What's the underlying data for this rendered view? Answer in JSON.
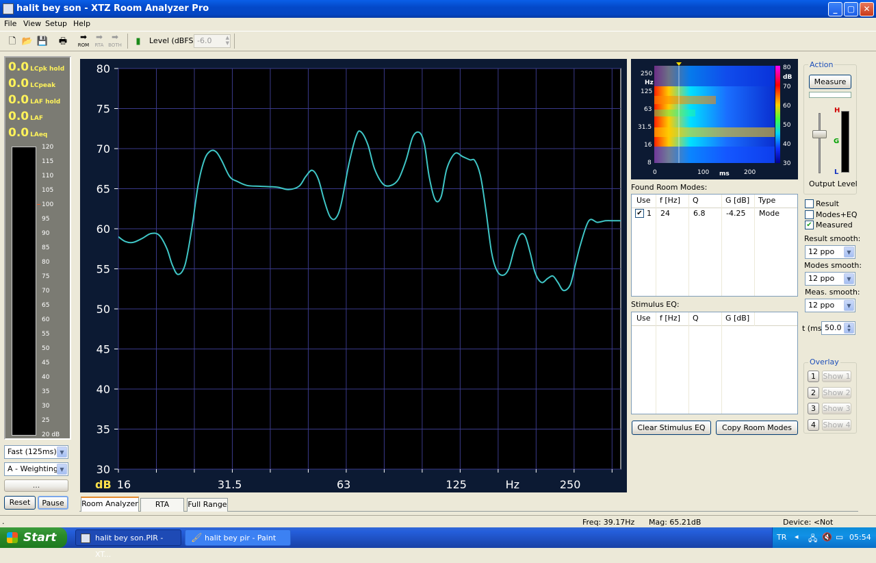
{
  "window": {
    "title": "halit bey son - XTZ Room Analyzer Pro",
    "min": "_",
    "max": "▢",
    "close": "✕"
  },
  "menu": [
    "File",
    "View",
    "Setup",
    "Help"
  ],
  "toolbar": {
    "rom": "ROM",
    "rta": "RTA",
    "both": "BOTH",
    "level_label": "Level (dBFS)",
    "level_value": "-6.0"
  },
  "meter": {
    "rows": [
      {
        "value": "0.0",
        "label": "LCpk hold"
      },
      {
        "value": "0.0",
        "label": "LCpeak"
      },
      {
        "value": "0.0",
        "label": "LAF hold"
      },
      {
        "value": "0.0",
        "label": "LAF"
      },
      {
        "value": "0.0",
        "label": "LAeq"
      }
    ],
    "scale": [
      "120",
      "115",
      "110",
      "105",
      "100",
      "95",
      "90",
      "85",
      "80",
      "75",
      "70",
      "65",
      "60",
      "55",
      "50",
      "45",
      "40",
      "35",
      "30",
      "25",
      "20 dB"
    ],
    "speed": "Fast (125ms)",
    "weighting": "A - Weighting",
    "dots": "...",
    "reset": "Reset",
    "pause": "Pause"
  },
  "chart_data": {
    "type": "line",
    "xlabel": "Hz",
    "ylabel": "dB",
    "x_scale": "log",
    "xlim": [
      16,
      340
    ],
    "ylim": [
      30,
      80
    ],
    "y_ticks": [
      30,
      35,
      40,
      45,
      50,
      55,
      60,
      65,
      70,
      75,
      80
    ],
    "x_tick_labels": [
      "16",
      "31.5",
      "63",
      "125",
      "Hz",
      "250"
    ],
    "grid": true,
    "line_color": "#3fc6c6",
    "series": [
      {
        "x": [
          16,
          16.7,
          17.5,
          18.5,
          19.5,
          20.5,
          21.5,
          22.2,
          23,
          24,
          25,
          26,
          27,
          28,
          29,
          30,
          31.5,
          33,
          35,
          38,
          42,
          45,
          48,
          50,
          52,
          54,
          56,
          58,
          60,
          62,
          65,
          68,
          70,
          73,
          76,
          80,
          84,
          88,
          92,
          96,
          100,
          103,
          106,
          110,
          114,
          118,
          124,
          130,
          136,
          140,
          145,
          150,
          155,
          160,
          166,
          172,
          178,
          184,
          190,
          196,
          202,
          210,
          218,
          225,
          232,
          240,
          250,
          258,
          266,
          280,
          295,
          310,
          325,
          335,
          340
        ],
        "y": [
          59,
          58.4,
          58.3,
          58.8,
          59.4,
          59.2,
          57.5,
          55.5,
          54.3,
          55.5,
          60,
          65.5,
          68.6,
          69.7,
          69.6,
          68.5,
          66.5,
          65.9,
          65.4,
          65.3,
          65.2,
          64.9,
          65.3,
          66.5,
          67.3,
          66.2,
          63.5,
          61.5,
          61.3,
          63,
          68,
          71.6,
          72.1,
          70.5,
          67.5,
          65.6,
          65.4,
          66.2,
          68.5,
          71.5,
          72,
          70.5,
          66.5,
          63.6,
          64,
          67.5,
          69.4,
          69,
          68.6,
          68.5,
          66.5,
          62,
          57,
          54.8,
          54.2,
          55,
          57.5,
          59.2,
          59.1,
          57,
          54.5,
          53.3,
          53.8,
          54.1,
          53.3,
          52.3,
          53,
          55.5,
          58,
          61,
          60.8,
          61,
          61,
          61,
          61
        ]
      }
    ]
  },
  "spectrogram": {
    "y_labels": [
      "250",
      "Hz",
      "125",
      "63",
      "31.5",
      "16",
      "8"
    ],
    "x_labels": [
      "0",
      "100",
      "ms",
      "200"
    ],
    "scale_labels": [
      "80",
      "dB",
      "70",
      "60",
      "50",
      "40",
      "30"
    ]
  },
  "action": {
    "group": "Action",
    "measure": "Measure",
    "output_level": "Output Level",
    "meter_letters": {
      "h": "H",
      "g": "G",
      "l": "L"
    }
  },
  "room_modes": {
    "title": "Found Room Modes:",
    "headers": [
      "Use",
      "f [Hz]",
      "Q",
      "G [dB]",
      "Type"
    ],
    "rows": [
      {
        "use_mark": "✔",
        "use": "1",
        "f": "24",
        "q": "6.8",
        "g": "-4.25",
        "type": "Mode"
      }
    ]
  },
  "stimulus_eq": {
    "title": "Stimulus EQ:",
    "headers": [
      "Use",
      "f [Hz]",
      "Q",
      "G [dB]"
    ]
  },
  "buttons": {
    "clear_eq": "Clear Stimulus EQ",
    "copy_modes": "Copy Room Modes"
  },
  "options": {
    "result": "Result",
    "modes_eq": "Modes+EQ",
    "measured": "Measured",
    "check_mark": "✔",
    "result_smooth": "Result smooth:",
    "result_smooth_val": "12 ppo",
    "modes_smooth": "Modes smooth:",
    "modes_smooth_val": "12 ppo",
    "meas_smooth": "Meas. smooth:",
    "meas_smooth_val": "12 ppo",
    "t_label": "t (ms)",
    "t_value": "50.0"
  },
  "overlay": {
    "group": "Overlay",
    "items": [
      {
        "num": "1",
        "show": "Show 1"
      },
      {
        "num": "2",
        "show": "Show 2"
      },
      {
        "num": "3",
        "show": "Show 3"
      },
      {
        "num": "4",
        "show": "Show 4"
      }
    ]
  },
  "tabs": [
    "Room Analyzer",
    "RTA",
    "Full Range"
  ],
  "status": {
    "left": ".",
    "freq": "Freq: 39.17Hz",
    "mag": "Mag: 65.21dB",
    "device": "Device: <Not Connected>"
  },
  "taskbar": {
    "start": "Start",
    "tasks": [
      "halit bey son.PIR - XT...",
      "halit bey pir - Paint"
    ],
    "lang": "TR",
    "tray_arrow": "◂",
    "time": "05:54"
  }
}
